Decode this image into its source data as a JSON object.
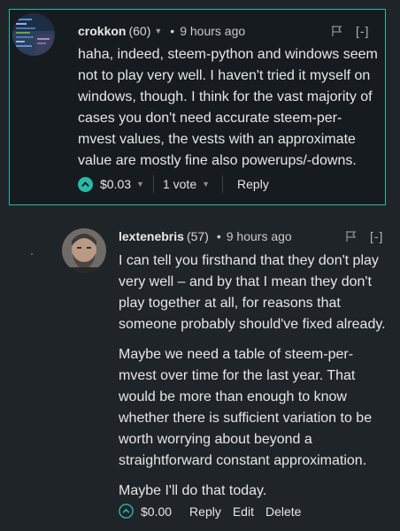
{
  "comments": [
    {
      "author": "crokkon",
      "reputation": "(60)",
      "time": "9 hours ago",
      "collapse_label": "[-]",
      "body": [
        "haha, indeed, steem-python and windows seem not to play very well. I haven't tried it myself on windows, though. I think for the vast majority of cases you don't need accurate steem-per-mvest values, the vests with an approximate value are mostly fine also powerups/-downs."
      ],
      "payout": "$0.03",
      "votes": "1 vote",
      "actions": {
        "reply": "Reply"
      },
      "icons": {
        "flag": "flag-icon",
        "upvote": "upvote-icon"
      },
      "highlighted": true,
      "accent_color": "#2ab9a5"
    },
    {
      "author": "lextenebris",
      "reputation": "(57)",
      "time": "9 hours ago",
      "collapse_label": "[-]",
      "body": [
        "I can tell you firsthand that they don't play very well – and by that I mean they don't play together at all, for reasons that someone probably should've fixed already.",
        "Maybe we need a table of steem-per-mvest over time for the last year. That would be more than enough to know whether there is sufficient variation to be worth worrying about beyond a straightforward constant approximation.",
        "Maybe I'll do that today."
      ],
      "payout": "$0.00",
      "actions": {
        "reply": "Reply",
        "edit": "Edit",
        "delete": "Delete"
      },
      "icons": {
        "flag": "flag-icon",
        "upvote": "upvote-icon"
      },
      "highlighted": false
    }
  ],
  "colors": {
    "background": "#1f2429",
    "highlight_background": "#161b20",
    "accent": "#2ab9a5"
  }
}
